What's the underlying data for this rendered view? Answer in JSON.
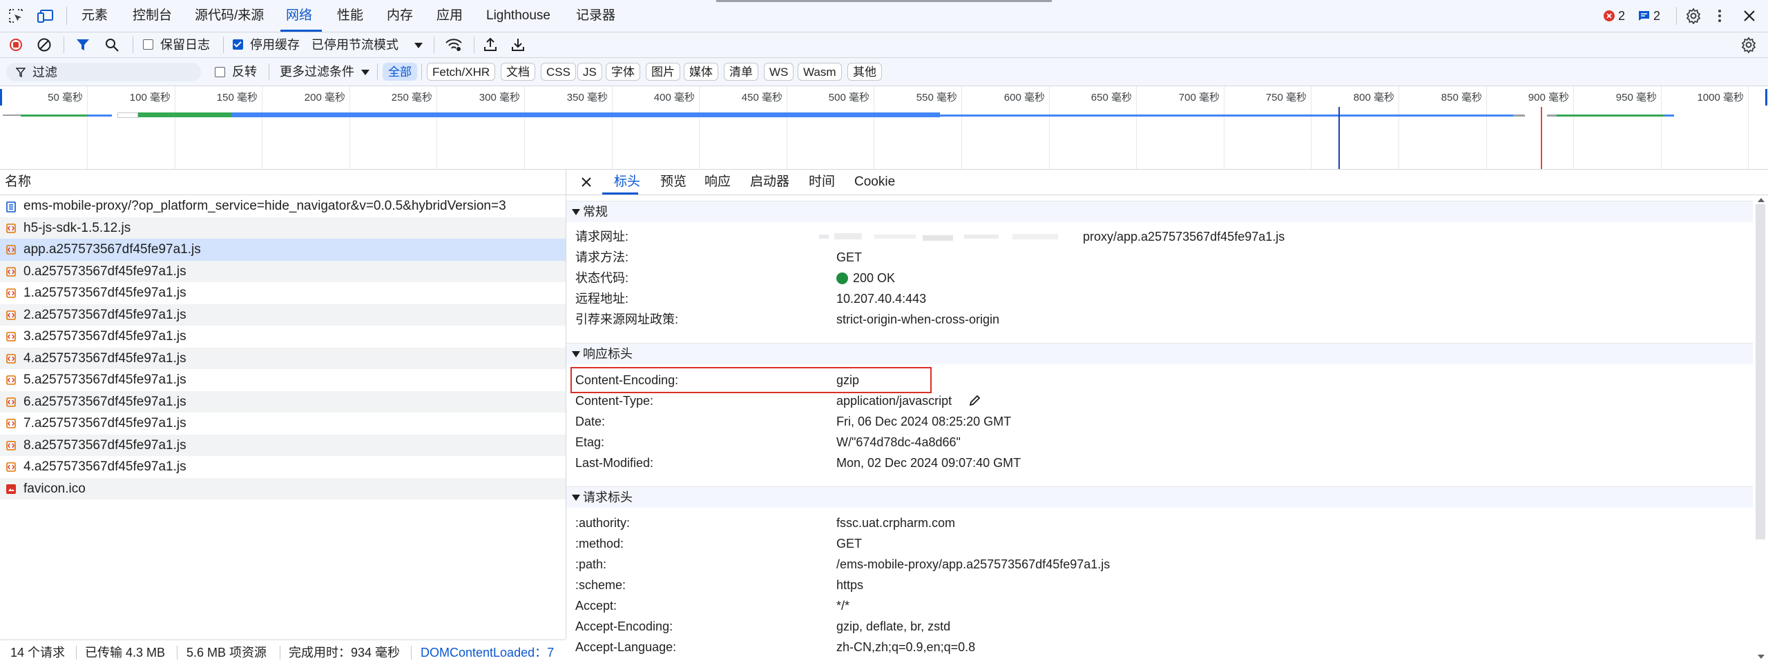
{
  "tabs": {
    "items": [
      "元素",
      "控制台",
      "源代码/来源",
      "网络",
      "性能",
      "内存",
      "应用",
      "Lighthouse",
      "记录器"
    ],
    "active_index": 3
  },
  "badges": {
    "errors": "2",
    "messages": "2"
  },
  "toolbar": {
    "preserve_log": "保留日志",
    "preserve_log_checked": false,
    "disable_cache": "停用缓存",
    "disable_cache_checked": true,
    "throttling": "已停用节流模式"
  },
  "filter": {
    "placeholder": "过滤",
    "invert": "反转",
    "more_filters": "更多过滤条件",
    "chips": [
      "全部",
      "Fetch/XHR",
      "文档",
      "CSS",
      "JS",
      "字体",
      "图片",
      "媒体",
      "清单",
      "WS",
      "Wasm",
      "其他"
    ],
    "active_chip": 0
  },
  "timeline": {
    "ticks": [
      "50 毫秒",
      "100 毫秒",
      "150 毫秒",
      "200 毫秒",
      "250 毫秒",
      "300 毫秒",
      "350 毫秒",
      "400 毫秒",
      "450 毫秒",
      "500 毫秒",
      "550 毫秒",
      "600 毫秒",
      "650 毫秒",
      "700 毫秒",
      "750 毫秒",
      "800 毫秒",
      "850 毫秒",
      "900 毫秒",
      "950 毫秒",
      "1000 毫秒"
    ],
    "colors": {
      "dom_content_loaded": "#1a3fa8",
      "load": "#e8453c",
      "bar_blue": "#4285f4",
      "bar_green": "#34a853"
    }
  },
  "requests": {
    "header": "名称",
    "rows": [
      {
        "name": "ems-mobile-proxy/?op_platform_service=hide_navigator&v=0.0.5&hybridVersion=3",
        "type": "document"
      },
      {
        "name": "h5-js-sdk-1.5.12.js",
        "type": "script"
      },
      {
        "name": "app.a257573567df45fe97a1.js",
        "type": "script",
        "selected": true
      },
      {
        "name": "0.a257573567df45fe97a1.js",
        "type": "script"
      },
      {
        "name": "1.a257573567df45fe97a1.js",
        "type": "script"
      },
      {
        "name": "2.a257573567df45fe97a1.js",
        "type": "script"
      },
      {
        "name": "3.a257573567df45fe97a1.js",
        "type": "script"
      },
      {
        "name": "4.a257573567df45fe97a1.js",
        "type": "script"
      },
      {
        "name": "5.a257573567df45fe97a1.js",
        "type": "script"
      },
      {
        "name": "6.a257573567df45fe97a1.js",
        "type": "script"
      },
      {
        "name": "7.a257573567df45fe97a1.js",
        "type": "script"
      },
      {
        "name": "8.a257573567df45fe97a1.js",
        "type": "script"
      },
      {
        "name": "4.a257573567df45fe97a1.js",
        "type": "script"
      },
      {
        "name": "favicon.ico",
        "type": "image"
      }
    ]
  },
  "status": {
    "requests": "14 个请求",
    "transferred": "已传输 4.3 MB",
    "resources": "5.6 MB 项资源",
    "finish": "完成用时：934 毫秒",
    "dcl": "DOMContentLoaded：7"
  },
  "details": {
    "tabs": [
      "标头",
      "预览",
      "响应",
      "启动器",
      "时间",
      "Cookie"
    ],
    "active_tab": 0,
    "general": {
      "title": "常规",
      "rows": [
        {
          "k": "请求网址:",
          "v": "proxy/app.a257573567df45fe97a1.js"
        },
        {
          "k": "请求方法:",
          "v": "GET"
        },
        {
          "k": "状态代码:",
          "v": "200 OK"
        },
        {
          "k": "远程地址:",
          "v": "10.207.40.4:443"
        },
        {
          "k": "引荐来源网址政策:",
          "v": "strict-origin-when-cross-origin"
        }
      ]
    },
    "response": {
      "title": "响应标头",
      "rows": [
        {
          "k": "Content-Encoding:",
          "v": "gzip"
        },
        {
          "k": "Content-Type:",
          "v": "application/javascript"
        },
        {
          "k": "Date:",
          "v": "Fri, 06 Dec 2024 08:25:20 GMT"
        },
        {
          "k": "Etag:",
          "v": "W/\"674d78dc-4a8d66\""
        },
        {
          "k": "Last-Modified:",
          "v": "Mon, 02 Dec 2024 09:07:40 GMT"
        }
      ]
    },
    "request": {
      "title": "请求标头",
      "rows": [
        {
          "k": ":authority:",
          "v": "fssc.uat.crpharm.com"
        },
        {
          "k": ":method:",
          "v": "GET"
        },
        {
          "k": ":path:",
          "v": "/ems-mobile-proxy/app.a257573567df45fe97a1.js"
        },
        {
          "k": ":scheme:",
          "v": "https"
        },
        {
          "k": "Accept:",
          "v": "*/*"
        },
        {
          "k": "Accept-Encoding:",
          "v": "gzip, deflate, br, zstd"
        },
        {
          "k": "Accept-Language:",
          "v": "zh-CN,zh;q=0.9,en;q=0.8"
        }
      ]
    },
    "highlight_color": "#d93025",
    "status_color": "#1e8e3e"
  }
}
